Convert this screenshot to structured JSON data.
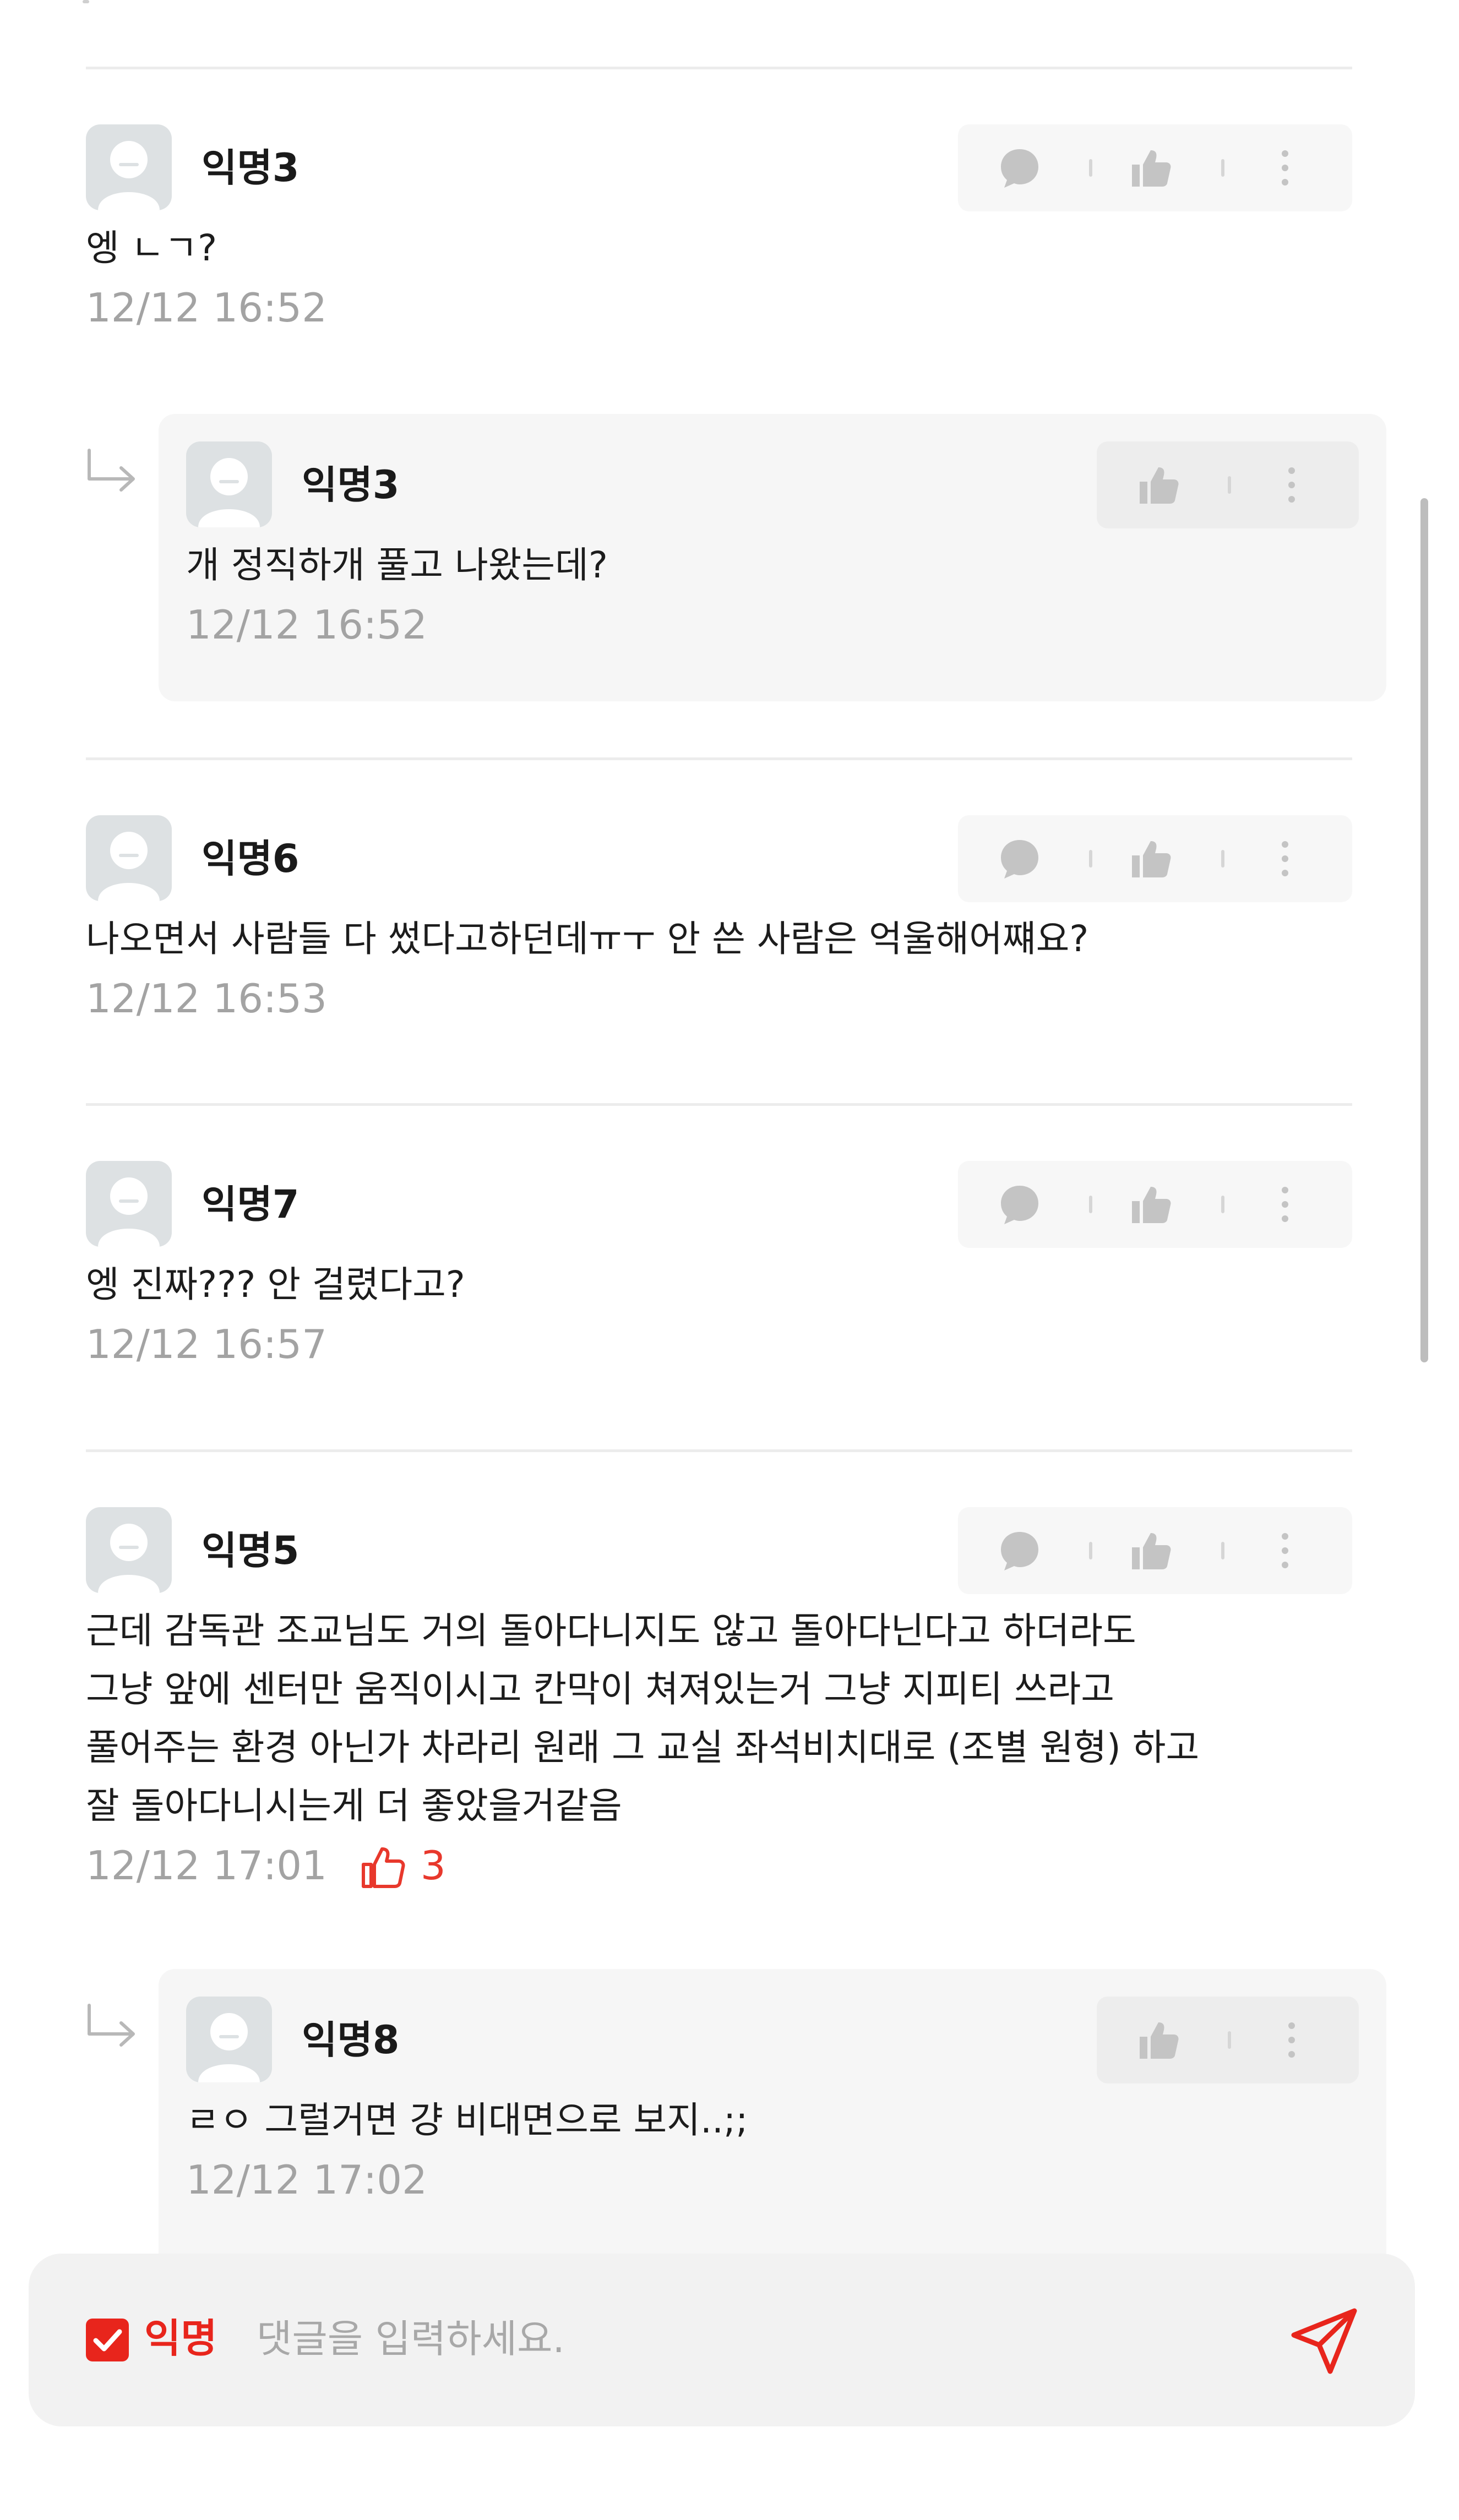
{
  "comments": [
    {
      "author": "익명3",
      "text": [
        "엥 ㄴㄱ?"
      ],
      "time": "12/12 16:52",
      "likes": ""
    },
    {
      "author": "익명6",
      "text": [
        "나오면서 사람들 다 썼다고하던데ㅠㅜ 안 쓴 사람은 억울해어쨰요?"
      ],
      "time": "12/12 16:53",
      "likes": ""
    },
    {
      "author": "익명7",
      "text": [
        "엥 진짜??? 안 걸렸다고?"
      ],
      "time": "12/12 16:57",
      "likes": ""
    },
    {
      "author": "익명5",
      "text": [
        "근데 감독관 조교님도 거의 돌아다니지도 않고 돌아다닌다고 하더라도",
        "그냥 앞에 센터만 움직이시고 칸막이 쳐져있는거 그냥 지피티 쓰라고",
        "풀어주는 환경 아닌가 차라리 원래 그 교실 좌석비치대로 (조별 원형) 하고",
        "잘 돌아다니시는게 더 좋았을거같음"
      ],
      "time": "12/12 17:01",
      "likes": "3"
    }
  ],
  "replies": [
    {
      "author": "익명3",
      "text": "개 정직하개 풀고 나왔는데?",
      "time": "12/12 16:52"
    },
    {
      "author": "익명8",
      "text": "ㄹㅇ 그럴거면 걍 비대면으로 보지..;;",
      "time": "12/12 17:02"
    }
  ],
  "icons": {
    "avatar": "default-avatar-icon",
    "reply": "speech-bubble-icon",
    "like": "thumbs-up-icon",
    "more": "vertical-dots-icon",
    "reply_marker": "reply-arrow-icon",
    "send": "paper-plane-icon",
    "checkbox": "checkbox-checked-icon"
  },
  "composer": {
    "anonymous_label": "익명",
    "anonymous_checked": true,
    "placeholder": "댓글을 입력하세요."
  },
  "colors": {
    "accent": "#e8251c",
    "meta_text": "#a3a3a3",
    "icon_gray": "#c4c4c4"
  }
}
